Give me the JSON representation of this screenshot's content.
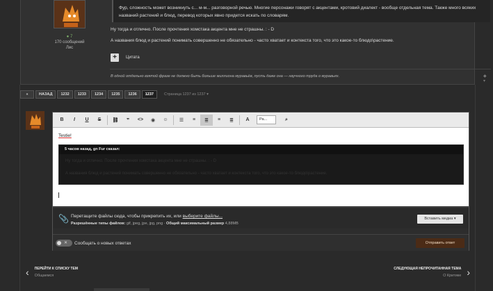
{
  "post": {
    "author": {
      "reputation": "7",
      "post_count": "170 сообщений",
      "rank": "Лис"
    },
    "quote_text": "Фур, сложность может возникнуть с... м-м... разговорной речью. Многие персонажи говорят с акцентами, кротовий диалект - вообще отдельная тема. Также много всяких названий растений и блюд, перевод которых явно придется искать по словарям.",
    "line1": "Ну тогда и отлично. После прочтения хомстака акцента мне не страшны. : - D",
    "line2": "А названия блюд и растений понимать совершенно не обязательно - часто хватает и контекста того, что это какое-то блюдо\\растение.",
    "quote_button": "Цитата",
    "signature": "В одной отдельно взятой фразе не должно быть больше миллиона муравьёв, пусть даже она — научного труда о муравьях.",
    "sig_actions": "◆ ▾"
  },
  "pagination": {
    "first": "«",
    "back": "НАЗАД",
    "pages": [
      "1232",
      "1233",
      "1234",
      "1235",
      "1236",
      "1237"
    ],
    "info": "Страница 1237 из 1237 ▾"
  },
  "editor": {
    "toolbar": {
      "bold": "B",
      "italic": "I",
      "underline": "U",
      "strike": "S",
      "link": "⛓",
      "quote": "❞",
      "code": "<>",
      "spoiler": "◉",
      "emoji": "☺",
      "bullets": "☰",
      "numbers": "≡",
      "align_left": "≣",
      "align_center": "≡",
      "align_right": "≣",
      "color": "A",
      "font_size": "Ра...",
      "preview": "⌕"
    },
    "text": "Testie!",
    "inner_quote_head": "5 часов назад, gn Fur сказал:",
    "inner_quote_line1": "Ну тогда и отлично. После прочтения хомстака акцента мне не страшны. : - D",
    "inner_quote_line2": "А названия блюд и растений понимать совершенно не обязательно - часто хватает и контекста того, что это какое-то блюдо\\растение.",
    "attach_text": "Перетащите файлы сюда, чтобы прикрепить их, или",
    "attach_link": "выберите файлы...",
    "allowed_label": "Разрешённые типы файлов:",
    "allowed_types": "gif, jpeg, jpe, jpg, png",
    "max_label": "Общий максимальный размер",
    "max_size": "4,88MB",
    "insert_media": "Вставить медиа ▾",
    "toggle_x": "✕",
    "notify": "Сообщать о новых ответах",
    "submit": "Отправить ответ"
  },
  "nav": {
    "prev_title": "ПЕРЕЙТИ К СПИСКУ ТЕМ",
    "prev_sub": "Общаемся",
    "next_title": "СЛЕДУЮЩАЯ НЕПРОЧИТАННАЯ ТЕМА",
    "next_sub": "О Критике"
  },
  "colors": {
    "accent": "#4b2b16",
    "reputation": "#7fb36a"
  }
}
